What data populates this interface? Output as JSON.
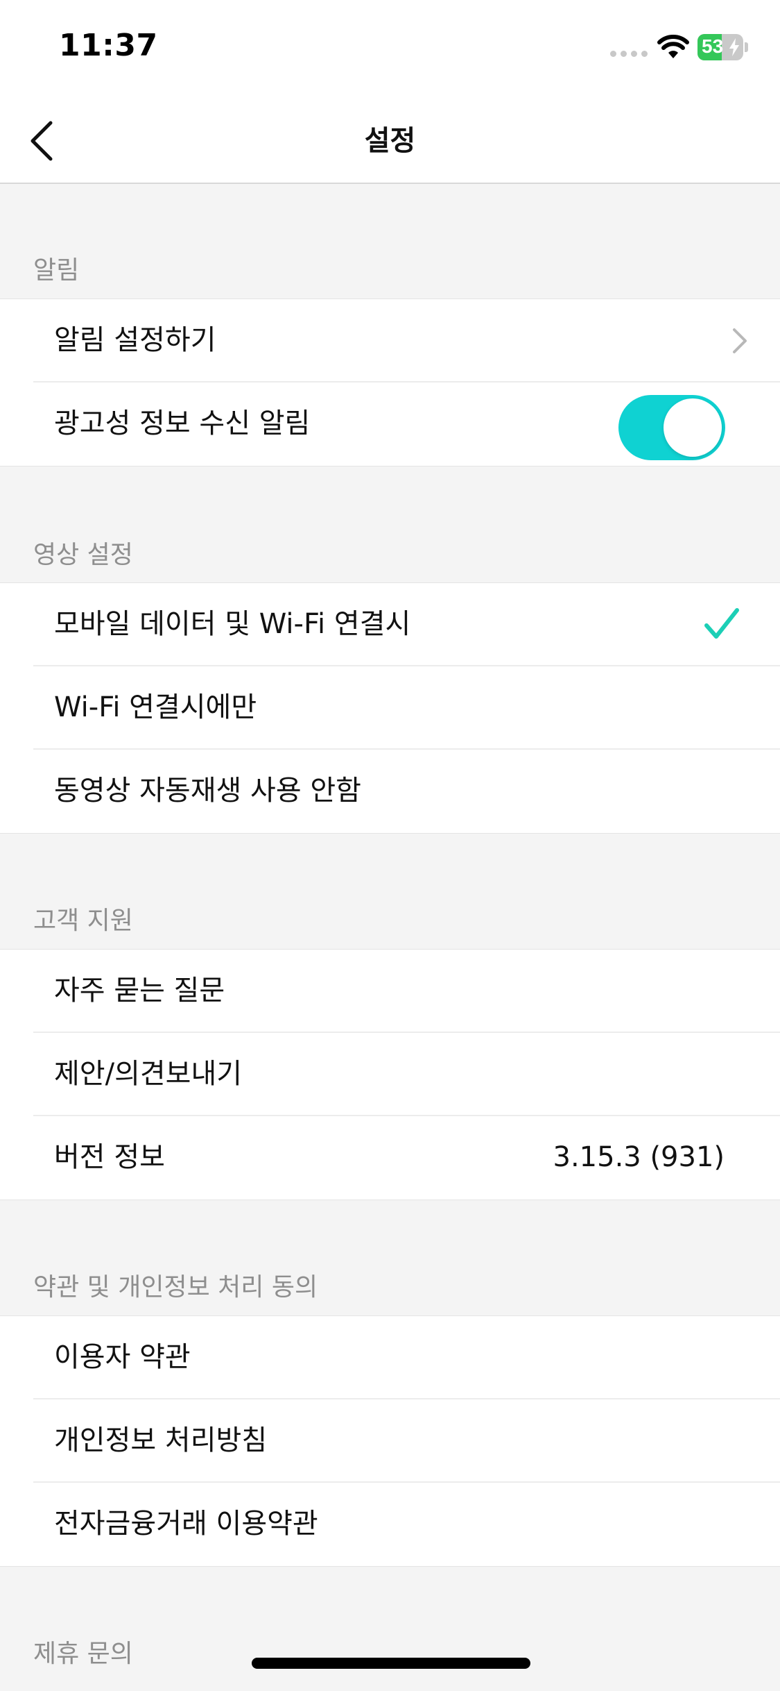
{
  "status_bar": {
    "time": "11:37",
    "battery": "53",
    "battery_percent": 53
  },
  "nav": {
    "title": "설정"
  },
  "sections": {
    "notifications": {
      "header": "알림",
      "item_settings": "알림 설정하기",
      "item_ad_alert": "광고성 정보 수신 알림",
      "ad_alert_on": true
    },
    "video": {
      "header": "영상 설정",
      "item_mobile_wifi": "모바일 데이터 및 Wi-Fi 연결시",
      "item_wifi_only": "Wi-Fi 연결시에만",
      "item_no_autoplay": "동영상 자동재생 사용 안함",
      "selected": "item_mobile_wifi"
    },
    "support": {
      "header": "고객 지원",
      "item_faq": "자주 묻는 질문",
      "item_feedback": "제안/의견보내기",
      "item_version": "버전 정보",
      "version_value": "3.15.3 (931)"
    },
    "terms": {
      "header": "약관 및 개인정보 처리 동의",
      "item_user_terms": "이용자 약관",
      "item_privacy": "개인정보 처리방침",
      "item_finance_terms": "전자금융거래 이용약관"
    },
    "partnership": {
      "header": "제휴 문의"
    }
  },
  "colors": {
    "accent": "#0fd2d2",
    "check": "#1ccfb6",
    "battery_green": "#34c759"
  }
}
